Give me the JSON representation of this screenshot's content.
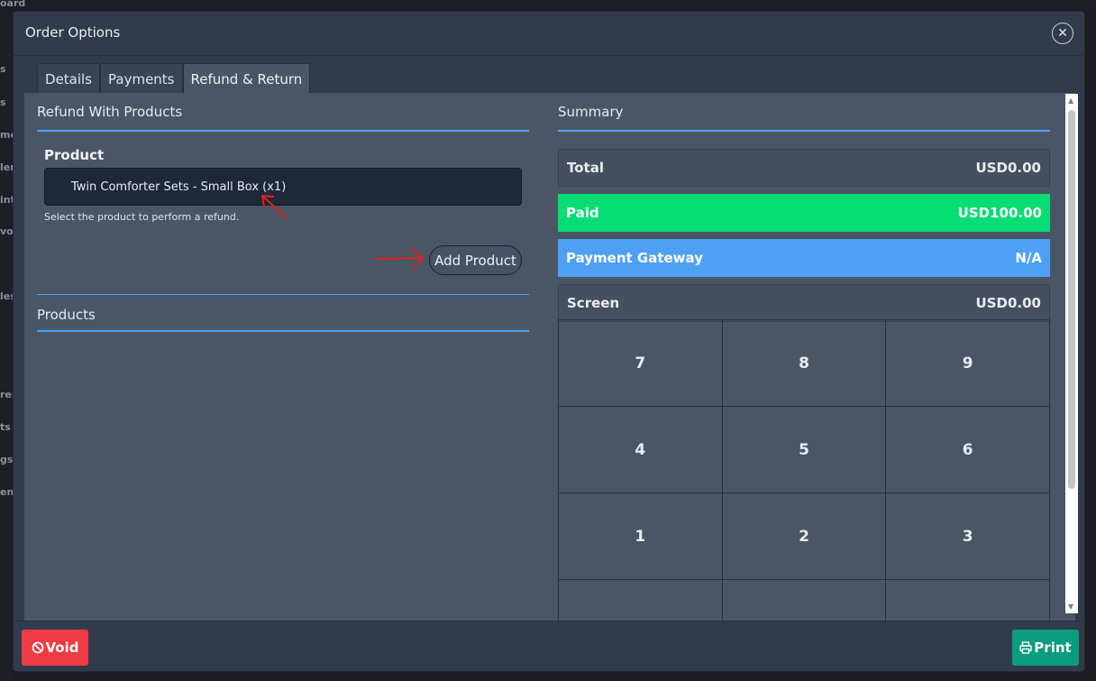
{
  "background": {
    "sidebar_fragments": [
      "oard",
      "s",
      "s",
      "me",
      "ler",
      "int",
      "vor",
      "les",
      "ren",
      "ts",
      "gs",
      "en"
    ]
  },
  "modal": {
    "title": "Order Options",
    "close_icon": "close-icon",
    "tabs": [
      {
        "label": "Details",
        "active": false
      },
      {
        "label": "Payments",
        "active": false
      },
      {
        "label": "Refund & Return",
        "active": true
      }
    ]
  },
  "refund": {
    "title": "Refund With Products",
    "product_label": "Product",
    "selected_product": "Twin Comforter Sets - Small Box (x1)",
    "help_text": "Select the product to perform a refund.",
    "add_button": "Add Product",
    "products_title": "Products"
  },
  "summary": {
    "title": "Summary",
    "rows": [
      {
        "label": "Total",
        "value": "USD0.00"
      },
      {
        "label": "Paid",
        "value": "USD100.00"
      },
      {
        "label": "Payment Gateway",
        "value": "N/A"
      },
      {
        "label": "Screen",
        "value": "USD0.00"
      }
    ],
    "keypad": [
      "7",
      "8",
      "9",
      "4",
      "5",
      "6",
      "1",
      "2",
      "3",
      "",
      "",
      ""
    ]
  },
  "footer": {
    "void_label": "Void",
    "void_icon": "ban-icon",
    "print_label": "Print",
    "print_icon": "printer-icon"
  },
  "colors": {
    "accent_blue": "#4ea0f5",
    "paid_green": "#06dd74",
    "void_red": "#f03a46",
    "print_teal": "#0b9b7f",
    "annotation_red": "#e0201b"
  }
}
